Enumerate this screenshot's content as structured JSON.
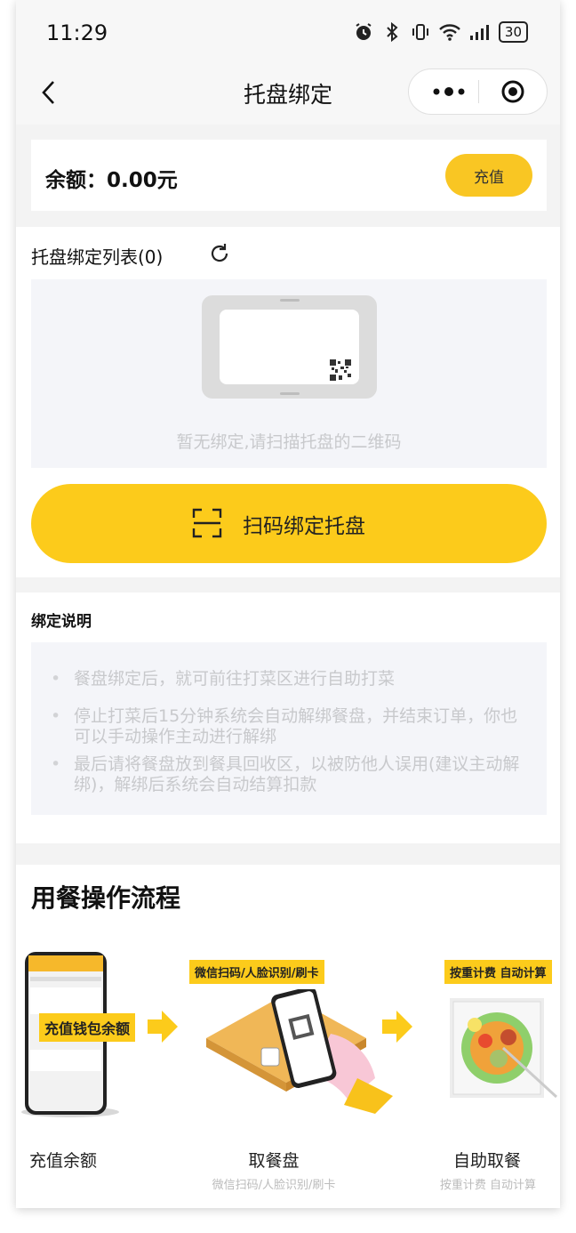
{
  "status": {
    "time": "11:29",
    "battery": "30"
  },
  "nav": {
    "title": "托盘绑定"
  },
  "balance": {
    "text": "余额：0.00元",
    "recharge_label": "充值"
  },
  "bind": {
    "list_title": "托盘绑定列表(0)",
    "empty_text": "暂无绑定,请扫描托盘的二维码",
    "scan_label": "扫码绑定托盘"
  },
  "desc": {
    "title": "绑定说明",
    "items": [
      "餐盘绑定后，就可前往打菜区进行自助打菜",
      "停止打菜后15分钟系统会自动解绑餐盘，并结束订单，你也可以手动操作主动进行解绑",
      "最后请将餐盘放到餐具回收区，以被防他人误用(建议主动解绑)，解绑后系统会自动结算扣款"
    ]
  },
  "flow": {
    "title": "用餐操作流程",
    "steps": [
      {
        "label": "充值余额",
        "tag": "充值钱包余额"
      },
      {
        "label": "取餐盘",
        "sub": "微信扫码/人脸识别/刷卡",
        "tag": "微信扫码/人脸识别/刷卡"
      },
      {
        "label": "自助取餐",
        "sub": "按重计费 自动计算",
        "tag": "按重计费  自动计算"
      }
    ]
  },
  "colors": {
    "accent": "#fccb1b",
    "accent_dark": "#f9c623"
  }
}
